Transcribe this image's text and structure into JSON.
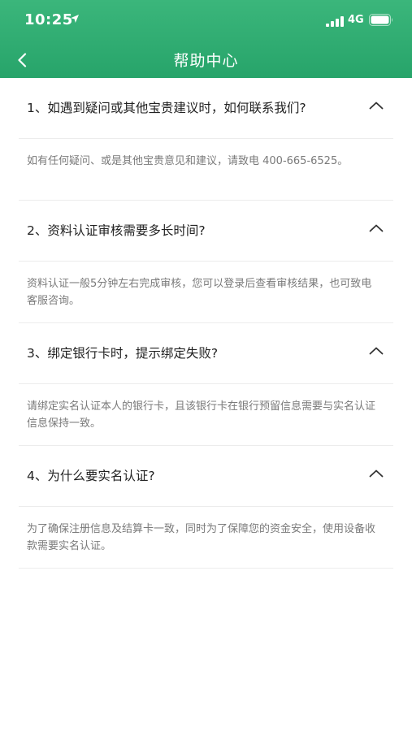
{
  "status_bar": {
    "time": "10:25",
    "network": "4G"
  },
  "nav": {
    "title": "帮助中心",
    "back_icon": "chevron-left-icon"
  },
  "faq": [
    {
      "question": "1、如遇到疑问或其他宝贵建议时，如何联系我们?",
      "answer": "如有任何疑问、或是其他宝贵意见和建议，请致电 400-665-6525。"
    },
    {
      "question": "2、资料认证审核需要多长时间?",
      "answer": "资料认证一般5分钟左右完成审核，您可以登录后查看审核结果，也可致电客服咨询。"
    },
    {
      "question": "3、绑定银行卡时，提示绑定失败?",
      "answer": "请绑定实名认证本人的银行卡，且该银行卡在银行预留信息需要与实名认证信息保持一致。"
    },
    {
      "question": "4、为什么要实名认证?",
      "answer": "为了确保注册信息及结算卡一致，同时为了保障您的资金安全，使用设备收款需要实名认证。"
    }
  ],
  "colors": {
    "header_green": "#2eac70",
    "question_text": "#222222",
    "answer_text": "#7a7a7a",
    "divider": "#ececec"
  }
}
